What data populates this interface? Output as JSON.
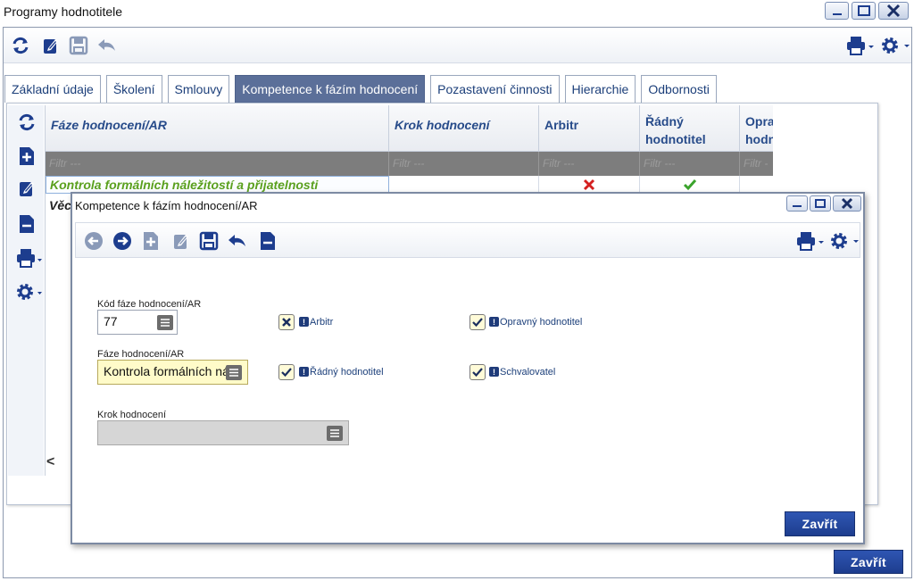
{
  "window": {
    "title": "Programy hodnotitele",
    "close_label": "Zavřít"
  },
  "tabs": [
    {
      "label": "Základní údaje"
    },
    {
      "label": "Školení"
    },
    {
      "label": "Smlouvy"
    },
    {
      "label": "Kompetence k fázím hodnocení"
    },
    {
      "label": "Pozastavení činnosti"
    },
    {
      "label": "Hierarchie"
    },
    {
      "label": "Odbornosti"
    }
  ],
  "grid": {
    "columns": [
      "Fáze hodnocení/AR",
      "Krok hodnocení",
      "Arbitr",
      "Řádný hodnotitel",
      "Opra hodn"
    ],
    "filter_placeholder": "Filtr ---",
    "rows": [
      {
        "faze": "Kontrola formálních náležitostí a přijatelnosti",
        "arbitr": "no",
        "radny": "yes"
      },
      {
        "faze": "Věc"
      }
    ],
    "scroll_hint": "<"
  },
  "modal": {
    "title": "Kompetence k fázím hodnocení/AR",
    "fields": {
      "kod_label": "Kód fáze hodnocení/AR",
      "kod_value": "77",
      "faze_label": "Fáze hodnocení/AR",
      "faze_value": "Kontrola formálních nál",
      "krok_label": "Krok hodnocení",
      "krok_value": ""
    },
    "checkboxes": {
      "arbitr": {
        "label": "Arbitr",
        "state": "x"
      },
      "radny": {
        "label": "Řádný hodnotitel",
        "state": "check"
      },
      "opravny": {
        "label": "Opravný hodnotitel",
        "state": "check"
      },
      "schvalovatel": {
        "label": "Schvalovatel",
        "state": "check"
      }
    },
    "close_label": "Zavřít"
  },
  "colors": {
    "accent": "#1d3d8e",
    "tab_active": "#5b6f99",
    "green_text": "#5aa01e",
    "red_x": "#d42020",
    "field_yellow": "#fffbc9"
  }
}
